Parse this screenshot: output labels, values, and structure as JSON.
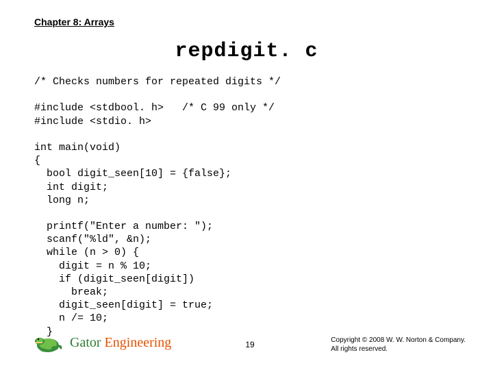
{
  "chapter": "Chapter 8: Arrays",
  "title": "repdigit. c",
  "code": "/* Checks numbers for repeated digits */\n\n#include <stdbool. h>   /* C 99 only */\n#include <stdio. h>\n\nint main(void)\n{\n  bool digit_seen[10] = {false};\n  int digit;\n  long n;\n\n  printf(\"Enter a number: \");\n  scanf(\"%ld\", &n);\n  while (n > 0) {\n    digit = n % 10;\n    if (digit_seen[digit])\n      break;\n    digit_seen[digit] = true;\n    n /= 10;\n  }",
  "brand": {
    "first": "Gator",
    "last": " Engineering"
  },
  "page_number": "19",
  "copyright_line1": "Copyright © 2008 W. W. Norton & Company.",
  "copyright_line2": "All rights reserved."
}
